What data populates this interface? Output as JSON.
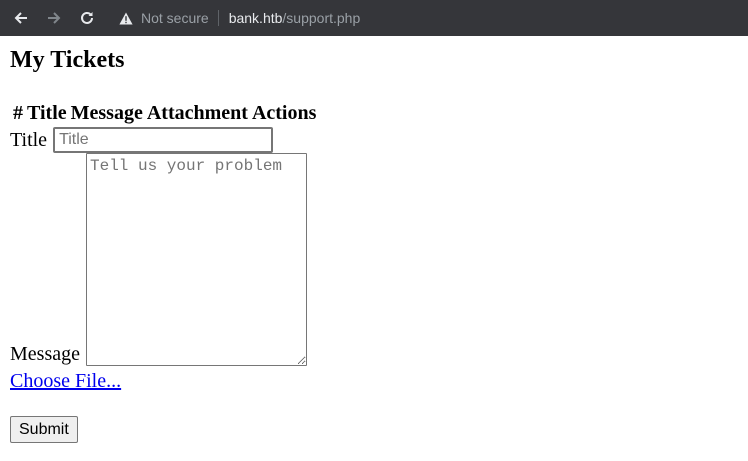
{
  "browser": {
    "security_label": "Not secure",
    "url_host": "bank.htb",
    "url_path": "/support.php"
  },
  "page": {
    "title": "My Tickets",
    "table_headers": [
      "#",
      "Title",
      "Message",
      "Attachment",
      "Actions"
    ]
  },
  "form": {
    "title_label": "Title",
    "title_placeholder": "Title",
    "message_label": "Message",
    "message_placeholder": "Tell us your problem",
    "file_link": "Choose File... ",
    "submit_label": "Submit"
  }
}
